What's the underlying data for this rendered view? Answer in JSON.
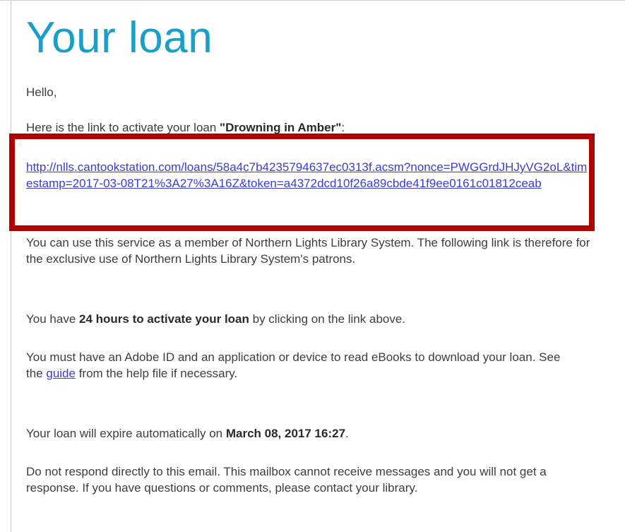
{
  "email": {
    "title": "Your loan",
    "greeting": "Hello,",
    "intro_prefix": "Here is the link to activate your loan ",
    "book_title": "\"Drowning in Amber\"",
    "intro_suffix": ":",
    "loan_link": "http://nlls.cantookstation.com/loans/58a4c7b4235794637ec0313f.acsm?nonce=PWGGrdJHJyVG2oL&timestamp=2017-03-08T21%3A27%3A16Z&token=a4372dcd10f26a89cbde41f9ee0161c01812ceab",
    "member_text": "You can use this service as a member of Northern Lights Library System. The following link is therefore for the exclusive use of Northern Lights Library System's patrons.",
    "hours_prefix": "You have ",
    "hours_bold": "24 hours to activate your loan",
    "hours_suffix": " by clicking on the link above.",
    "adobe_prefix": "You must have an Adobe ID and an application or device to read eBooks to download your loan. See the ",
    "guide_link": "guide",
    "adobe_suffix": " from the help file if necessary.",
    "expire_prefix": "Your loan will expire automatically on ",
    "expire_date": "March 08, 2017 16:27",
    "expire_suffix": ".",
    "noreply_text": "Do not respond directly to this email. This mailbox cannot receive messages and you will not get a response. If you have questions or comments, please contact your library."
  },
  "colors": {
    "title": "#1aa0c8",
    "link": "#3b3bd6",
    "highlight_box": "#b00000",
    "body_text": "#3d3d3d"
  }
}
